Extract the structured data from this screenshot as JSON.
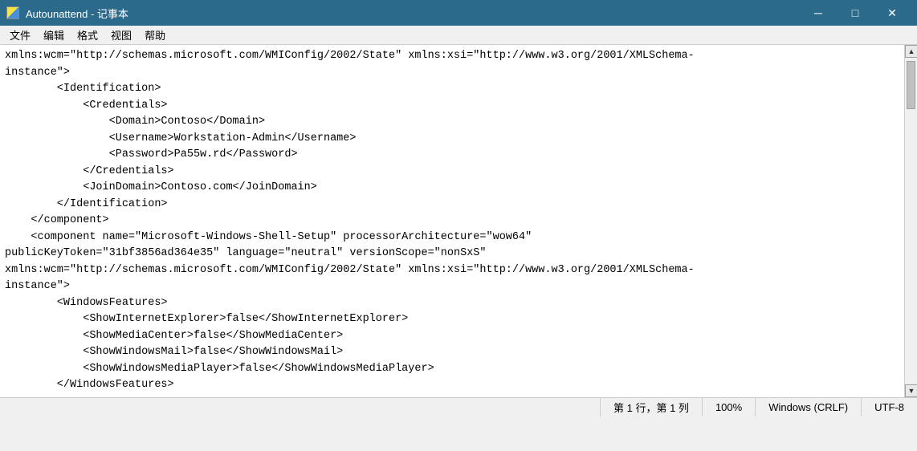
{
  "titleBar": {
    "title": "Autounattend - 记事本",
    "minBtn": "─",
    "maxBtn": "□",
    "closeBtn": "✕"
  },
  "menuBar": {
    "items": [
      "文件",
      "编辑",
      "格式",
      "视图",
      "帮助"
    ]
  },
  "editor": {
    "content": "xmlns:wcm=\"http://schemas.microsoft.com/WMIConfig/2002/State\" xmlns:xsi=\"http://www.w3.org/2001/XMLSchema-instance\">\n        <Identification>\n            <Credentials>\n                <Domain>Contoso</Domain>\n                <Username>Workstation-Admin</Username>\n                <Password>Pa55w.rd</Password>\n            </Credentials>\n            <JoinDomain>Contoso.com</JoinDomain>\n        </Identification>\n    </component>\n    <component name=\"Microsoft-Windows-Shell-Setup\" processorArchitecture=\"wow64\"\npublicKeyToken=\"31bf3856ad364e35\" language=\"neutral\" versionScope=\"nonSxS\"\nxmlns:wcm=\"http://schemas.microsoft.com/WMIConfig/2002/State\" xmlns:xsi=\"http://www.w3.org/2001/XMLSchema-instance\">\n        <WindowsFeatures>\n            <ShowInternetExplorer>false</ShowInternetExplorer>\n            <ShowMediaCenter>false</ShowMediaCenter>\n            <ShowWindowsMail>false</ShowWindowsMail>\n            <ShowWindowsMediaPlayer>false</ShowWindowsMediaPlayer>\n        </WindowsFeatures>\n"
  },
  "statusBar": {
    "position": "第 1 行，第 1 列",
    "zoom": "100%",
    "lineEnding": "Windows (CRLF)",
    "encoding": "UTF-8"
  }
}
